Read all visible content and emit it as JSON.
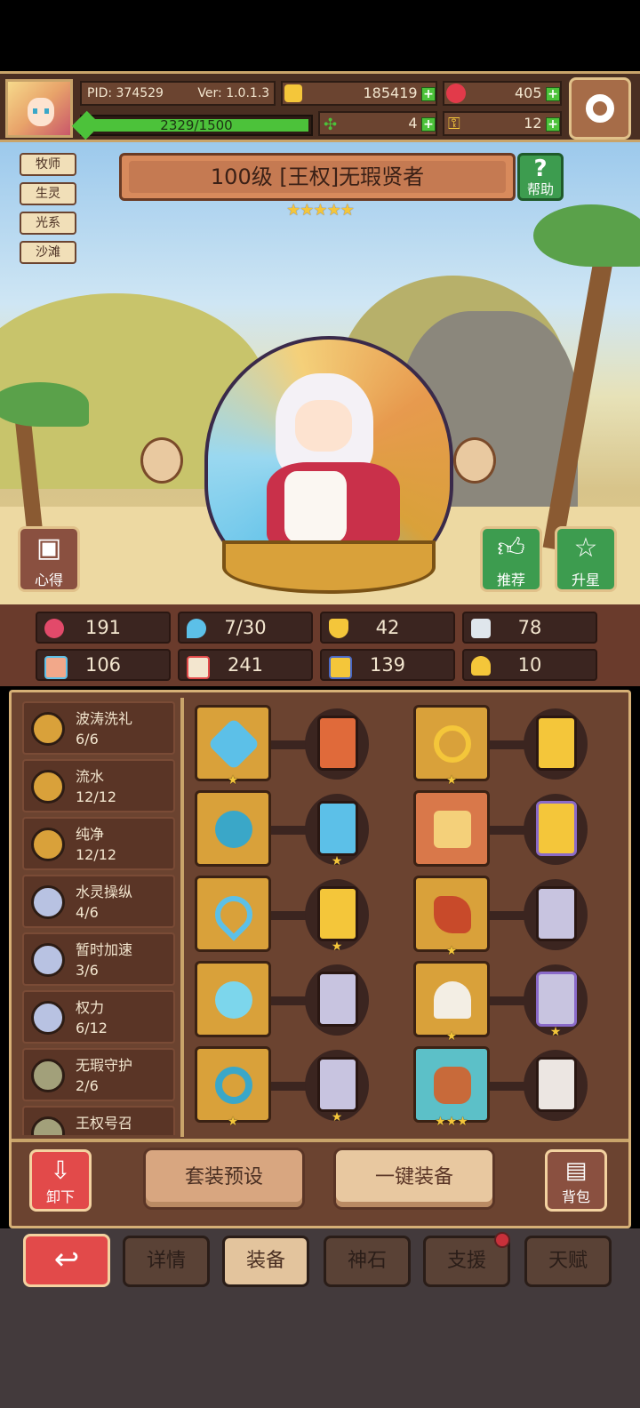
{
  "header": {
    "pid": "PID: 374529",
    "version": "Ver: 1.0.1.3",
    "gold": "185419",
    "gems": "405",
    "xp": "2329/1500",
    "clover": "4",
    "keys": "12",
    "avatar_icon": "heroine-portrait",
    "settings_icon": "gear-icon"
  },
  "tags": [
    "牧师",
    "生灵",
    "光系",
    "沙滩"
  ],
  "hero": {
    "title": "100级  [王权]无瑕贤者",
    "stars": "★★★★★",
    "help_label": "帮助",
    "notes_label": "心得",
    "recommend_label": "推荐",
    "upgrade_label": "升星"
  },
  "stats": [
    "191",
    "7/30",
    "42",
    "78",
    "106",
    "241",
    "139",
    "10"
  ],
  "sets": [
    {
      "name": "波涛洗礼",
      "count": "6/6"
    },
    {
      "name": "流水",
      "count": "12/12"
    },
    {
      "name": "纯净",
      "count": "12/12"
    },
    {
      "name": "水灵操纵",
      "count": "4/6"
    },
    {
      "name": "暂时加速",
      "count": "3/6"
    },
    {
      "name": "权力",
      "count": "6/12"
    },
    {
      "name": "无瑕守护",
      "count": "2/6"
    },
    {
      "name": "王权号召",
      "count": ""
    }
  ],
  "equipment": {
    "left_stars": [
      "★",
      "",
      "",
      "",
      "★"
    ],
    "left_rune_stars": [
      "",
      "★",
      "★",
      "",
      "★"
    ],
    "right_stars": [
      "★",
      "",
      "★",
      "★",
      "★★★"
    ],
    "right_rune_stars": [
      "",
      "",
      "",
      "★",
      ""
    ]
  },
  "actions": {
    "unequip_label": "卸下",
    "preset_label": "套装预设",
    "auto_equip_label": "一键装备",
    "bag_label": "背包"
  },
  "tabs": [
    "详情",
    "装备",
    "神石",
    "支援",
    "天赋"
  ],
  "colors": {
    "accent": "#c9a46a",
    "active_tab": "#e3c49d",
    "back": "#e24a4a"
  }
}
